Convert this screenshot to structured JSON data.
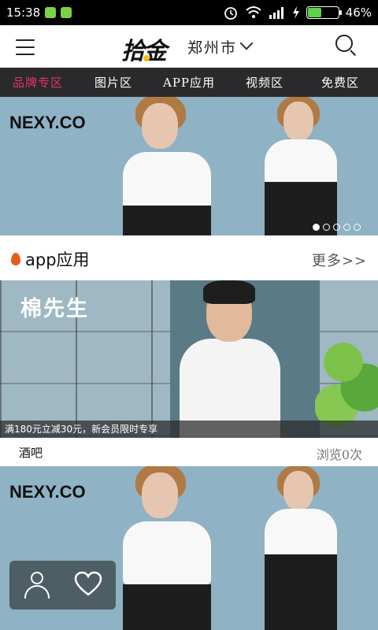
{
  "status_bar": {
    "time": "15:38",
    "battery_percent": 46,
    "battery_label": "46%",
    "icons": [
      "alarm-icon",
      "wifi-icon",
      "signal-icon",
      "charging-icon",
      "battery-icon"
    ]
  },
  "header": {
    "logo_text": "拾金",
    "city": "郑州市",
    "menu_icon": "menu-icon",
    "search_icon": "search-icon"
  },
  "nav": {
    "items": [
      {
        "label": "品牌专区",
        "active": true
      },
      {
        "label": "图片区",
        "active": false
      },
      {
        "label": "APP应用",
        "active": false
      },
      {
        "label": "视频区",
        "active": false
      },
      {
        "label": "免费区",
        "active": false
      }
    ],
    "active_color": "#e0336a"
  },
  "banner": {
    "brand": "NEXY.CO",
    "page_count": 5,
    "current_page": 1
  },
  "section": {
    "title": "app应用",
    "more_label": "更多>>",
    "icon": "flame-icon"
  },
  "card": {
    "brand": "棉先生",
    "promo": "满180元立减30元，新会员限时专享",
    "title": "酒吧",
    "views": "浏览0次"
  },
  "card2": {
    "brand": "NEXY.CO"
  },
  "float_bar": {
    "icons": [
      "user-icon",
      "heart-icon"
    ]
  }
}
